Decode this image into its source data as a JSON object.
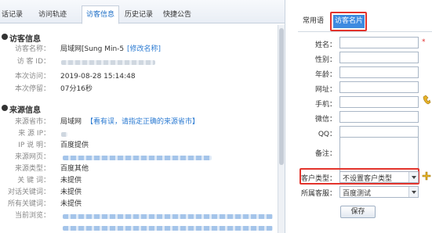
{
  "left": {
    "tabs": [
      "话记录",
      "访问轨迹",
      "访客信息",
      "历史记录",
      "快捷公告"
    ],
    "visitor": {
      "title": "访客信息",
      "name_label": "访客名称：",
      "name_value": "局域网[Sung Min-5",
      "edit_link": "[修改名称]",
      "id_label": "访 客 ID：",
      "time_label": "本次访问：",
      "time_value": "2019-08-28 15:14:48",
      "stay_label": "本次停留：",
      "stay_value": "07分16秒"
    },
    "source": {
      "title": "来源信息",
      "province_label": "来源省市：",
      "province_value": "局域网",
      "province_link": "【看有误，请指定正确的来源省市】",
      "ip_label": "来 源 IP：",
      "ipinfo_label": "IP 说 明：",
      "ipinfo_value": "百度提供",
      "page_label": "来源网页：",
      "type_label": "来源类型：",
      "type_value": "百度其他",
      "kw_label": "关 键 词：",
      "kw_value": "未提供",
      "dialog_kw_label": "对话关键词：",
      "dialog_kw_value": "未提供",
      "all_kw_label": "所有关键词：",
      "all_kw_value": "未提供",
      "cur_label": "当前浏览："
    }
  },
  "right": {
    "tabs": [
      "常用语",
      "访客名片"
    ],
    "fields": [
      {
        "label": "姓名：",
        "required": true
      },
      {
        "label": "性别："
      },
      {
        "label": "年龄："
      },
      {
        "label": "网址："
      },
      {
        "label": "手机："
      },
      {
        "label": "微信："
      },
      {
        "label": "QQ："
      },
      {
        "label": "备注："
      }
    ],
    "required_mark": "*",
    "customer_type_label": "客户类型：",
    "customer_type_value": "不设置客户类型",
    "owner_label": "所属客服：",
    "owner_value": "百度测试",
    "save_label": "保存"
  }
}
